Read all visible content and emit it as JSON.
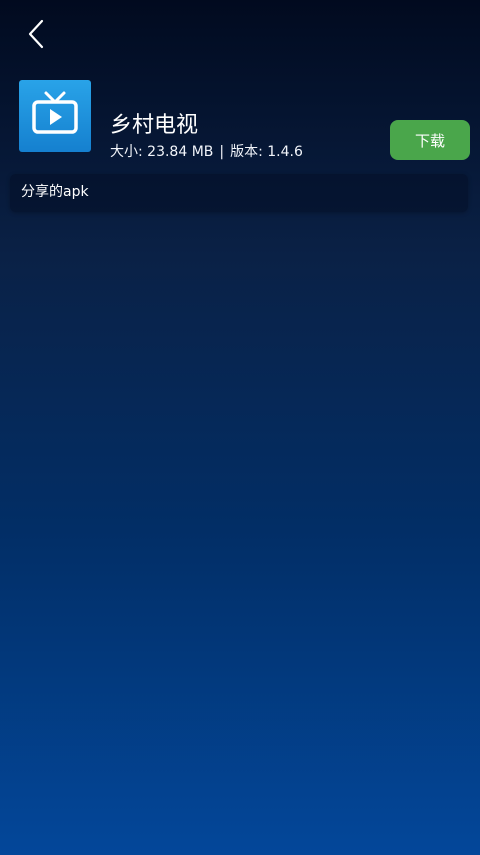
{
  "header": {
    "back_icon": "chevron-left-icon"
  },
  "app": {
    "icon": "tv-play-icon",
    "icon_color": "#1f92dc",
    "name": "乡村电视",
    "size": "大小: 23.84 MB",
    "separator": "|",
    "version": "版本: 1.4.6",
    "download_label": "下载",
    "download_color": "#4aa64b"
  },
  "description": {
    "text": "分享的apk"
  }
}
